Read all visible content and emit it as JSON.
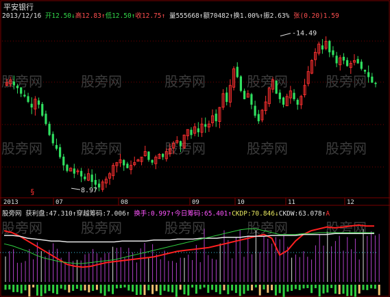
{
  "stock_name": "平安银行",
  "header": [
    {
      "text": "2013/12/16",
      "color": "#e0e0e0"
    },
    {
      "text": " 开12.50↓",
      "color": "#32d84a"
    },
    {
      "text": "高12.83↑",
      "color": "#ff5050"
    },
    {
      "text": "低12.50↑",
      "color": "#32d84a"
    },
    {
      "text": "收12.75↑",
      "color": "#ff5050"
    },
    {
      "text": " 量555668↑",
      "color": "#e0e0e0"
    },
    {
      "text": "额70482↑",
      "color": "#e0e0e0"
    },
    {
      "text": "换1.00%↑",
      "color": "#e0e0e0"
    },
    {
      "text": "振2.63%",
      "color": "#e0e0e0"
    },
    {
      "text": " 张(0.20)1.59",
      "color": "#ff5050"
    }
  ],
  "annotations": {
    "high_label": "14.49",
    "low_label": "8.97",
    "event_marker": "§"
  },
  "watermark": "股旁网",
  "x_axis": {
    "year": "2013",
    "months": [
      "07",
      "08",
      "09",
      "10",
      "11",
      "12"
    ]
  },
  "indicator_bar": [
    {
      "text": "股旁网",
      "color": "#e0e0e0"
    },
    {
      "text": " 获利盘:47.310↑",
      "color": "#e0e0e0"
    },
    {
      "text": "穿越筹码:7.006↑",
      "color": "#e0e0e0"
    },
    {
      "text": " 换手:0.997↑",
      "color": "#ff55ff"
    },
    {
      "text": "今日筹码:65.401↑",
      "color": "#ff55ff"
    },
    {
      "text": "CKDP:70.846↓",
      "color": "#e8e860"
    },
    {
      "text": "CKDW:63.078↑",
      "color": "#e0e0e0"
    },
    {
      "text": "A",
      "color": "#ff3030"
    }
  ],
  "colors": {
    "up": "#ff3030",
    "down": "#30e060",
    "grid": "#7a0000",
    "text": "#e0e0e0"
  },
  "chart_data": {
    "type": "candlestick",
    "title": "平安银行",
    "x_axis_labels": [
      "2013",
      "07",
      "08",
      "09",
      "10",
      "11",
      "12"
    ],
    "price_range": [
      8.7,
      15.1
    ],
    "annotated_high": 14.49,
    "annotated_low": 8.97,
    "last_bar": {
      "date": "2013/12/16",
      "open": 12.5,
      "high": 12.83,
      "low": 12.5,
      "close": 12.75,
      "volume": 555668,
      "amount": 70482,
      "turnover_pct": 1.0,
      "amplitude_pct": 2.63
    },
    "closes": [
      12.8,
      12.9,
      12.7,
      12.6,
      12.4,
      12.3,
      12.1,
      11.9,
      12.2,
      12.0,
      11.6,
      11.3,
      10.9,
      10.6,
      10.4,
      10.1,
      9.8,
      9.6,
      9.7,
      9.5,
      9.6,
      9.4,
      9.3,
      9.5,
      9.2,
      9.1,
      9.0,
      9.2,
      9.3,
      9.5,
      9.8,
      9.9,
      10.0,
      9.8,
      9.7,
      9.8,
      9.9,
      10.0,
      10.1,
      10.3,
      10.0,
      9.9,
      10.1,
      10.2,
      10.1,
      10.3,
      10.4,
      10.6,
      10.7,
      10.5,
      10.9,
      11.1,
      10.9,
      11.2,
      11.0,
      11.3,
      11.2,
      11.3,
      11.6,
      11.4,
      11.9,
      12.4,
      12.1,
      12.7,
      13.3,
      13.0,
      12.5,
      12.2,
      12.4,
      12.0,
      11.6,
      11.4,
      11.8,
      12.1,
      12.6,
      12.9,
      12.4,
      12.2,
      12.0,
      12.3,
      12.5,
      12.2,
      12.0,
      12.3,
      12.7,
      13.2,
      13.6,
      13.9,
      14.2,
      14.0,
      14.3,
      13.9,
      13.8,
      13.5,
      13.7,
      13.6,
      13.4,
      13.5,
      13.6,
      13.5,
      13.3,
      13.2,
      13.0,
      12.8,
      12.75
    ],
    "indicators": {
      "获利盘": 47.31,
      "穿越筹码": 7.006,
      "换手": 0.997,
      "今日筹码": 65.401,
      "CKDP": 70.846,
      "CKDW": 63.078
    },
    "series": [
      {
        "name": "CKDP",
        "values": [
          66,
          64,
          60,
          55,
          50,
          45,
          40,
          35,
          30,
          28,
          27,
          28,
          30,
          32,
          33,
          34,
          35,
          36,
          37,
          38,
          40,
          42,
          44,
          45,
          46,
          47,
          48,
          50,
          52,
          54,
          56,
          58,
          60,
          62,
          58,
          40,
          45,
          55,
          62,
          66,
          68,
          70,
          69,
          70,
          71,
          72,
          71,
          71
        ]
      },
      {
        "name": "CKDW",
        "values": [
          61,
          61,
          60,
          58,
          57,
          56,
          55,
          55,
          54,
          54,
          54,
          54,
          54,
          54,
          54,
          55,
          55,
          55,
          55,
          56,
          56,
          56,
          57,
          57,
          57,
          58,
          58,
          58,
          59,
          59,
          59,
          60,
          60,
          60,
          61,
          61,
          61,
          61,
          62,
          62,
          62,
          62,
          63,
          63,
          63,
          63,
          63,
          63
        ]
      },
      {
        "name": "获利盘",
        "values": [
          52,
          50,
          47,
          44,
          40,
          37,
          35,
          33,
          32,
          31,
          31,
          32,
          33,
          34,
          35,
          37,
          39,
          41,
          43,
          45,
          47,
          49,
          51,
          53,
          55,
          57,
          59,
          61,
          63,
          65,
          67,
          68,
          68,
          66,
          64,
          62,
          62,
          62,
          63,
          63,
          64,
          64,
          64,
          64,
          64,
          64,
          64,
          64
        ]
      }
    ]
  }
}
